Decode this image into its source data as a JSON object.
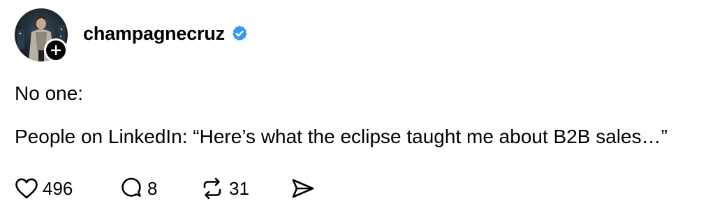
{
  "post": {
    "username": "champagnecruz",
    "verified": true,
    "accent_color": "#3897f0",
    "line1": "No one:",
    "line2": "People on LinkedIn: “Here’s what the eclipse taught me about B2B sales…”"
  },
  "actions": {
    "like_icon": "heart-icon",
    "like_count": "496",
    "reply_icon": "comment-icon",
    "reply_count": "8",
    "repost_icon": "repost-icon",
    "repost_count": "31",
    "share_icon": "send-icon"
  }
}
